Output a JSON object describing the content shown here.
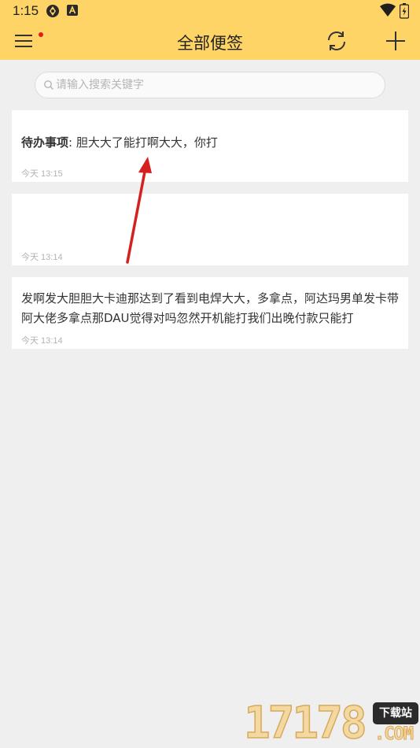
{
  "status_bar": {
    "time": "1:15",
    "left_icons": [
      "app-notification-icon",
      "keyboard-a-icon"
    ],
    "right_icons": [
      "wifi-icon",
      "battery-icon"
    ]
  },
  "header": {
    "title": "全部便签",
    "accent_color": "#ffd466",
    "menu_icon": "hamburger-menu-icon",
    "sync_icon": "sync-icon",
    "add_icon": "plus-icon",
    "menu_badge_color": "#e21b1b"
  },
  "search": {
    "placeholder": "请输入搜索关键字",
    "value": ""
  },
  "notes": [
    {
      "prefix": "待办事项",
      "text": ": 胆大大了能打啊大大，你打",
      "time": "今天 13:15"
    },
    {
      "prefix": "",
      "text": "",
      "time": "今天 13:14"
    },
    {
      "prefix": "",
      "text": "发啊发大胆胆大卡迪那达到了看到电焊大大，多拿点，阿达玛男单发卡带阿大佬多拿点那DAU觉得对吗忽然开机能打我们出晚付款只能打",
      "time": "今天 13:14"
    }
  ],
  "annotation": {
    "arrow_color": "#d61f1f"
  },
  "watermark": {
    "digits": "17178",
    "badge": "下载站",
    "domain": ".COM"
  }
}
